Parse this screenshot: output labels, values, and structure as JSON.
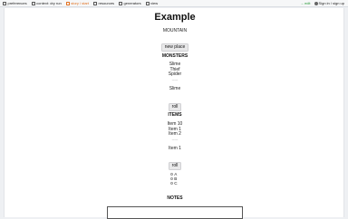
{
  "topbar": {
    "nav": [
      {
        "label": "preferences",
        "icon": "preferences-icon",
        "active": false
      },
      {
        "label": "context: dry run",
        "icon": "context-icon",
        "active": false
      },
      {
        "label": "story / start",
        "icon": "story-icon",
        "active": true
      },
      {
        "label": "resources",
        "icon": "resources-icon",
        "active": false
      },
      {
        "label": "generators",
        "icon": "generators-icon",
        "active": false
      },
      {
        "label": "view",
        "icon": "view-icon",
        "active": false
      }
    ],
    "edit_label": "edit",
    "sign_in_label": "Sign in / sign up"
  },
  "main": {
    "title": "Example",
    "location": "MOUNTAIN",
    "new_place_button": "new place",
    "monsters": {
      "heading": "MONSTERS",
      "list": [
        "Slime",
        "Thief",
        "Spider"
      ],
      "divider": "-----",
      "selected": "Slime",
      "action_button": "roll"
    },
    "items": {
      "heading": "ITEMS",
      "list": [
        "Item 10",
        "Item 1",
        "Item 2"
      ],
      "divider": "-----",
      "selected": "Item 1",
      "action_button": "roll"
    },
    "options": [
      "A",
      "B",
      "C"
    ],
    "notes_heading": "NOTES"
  }
}
